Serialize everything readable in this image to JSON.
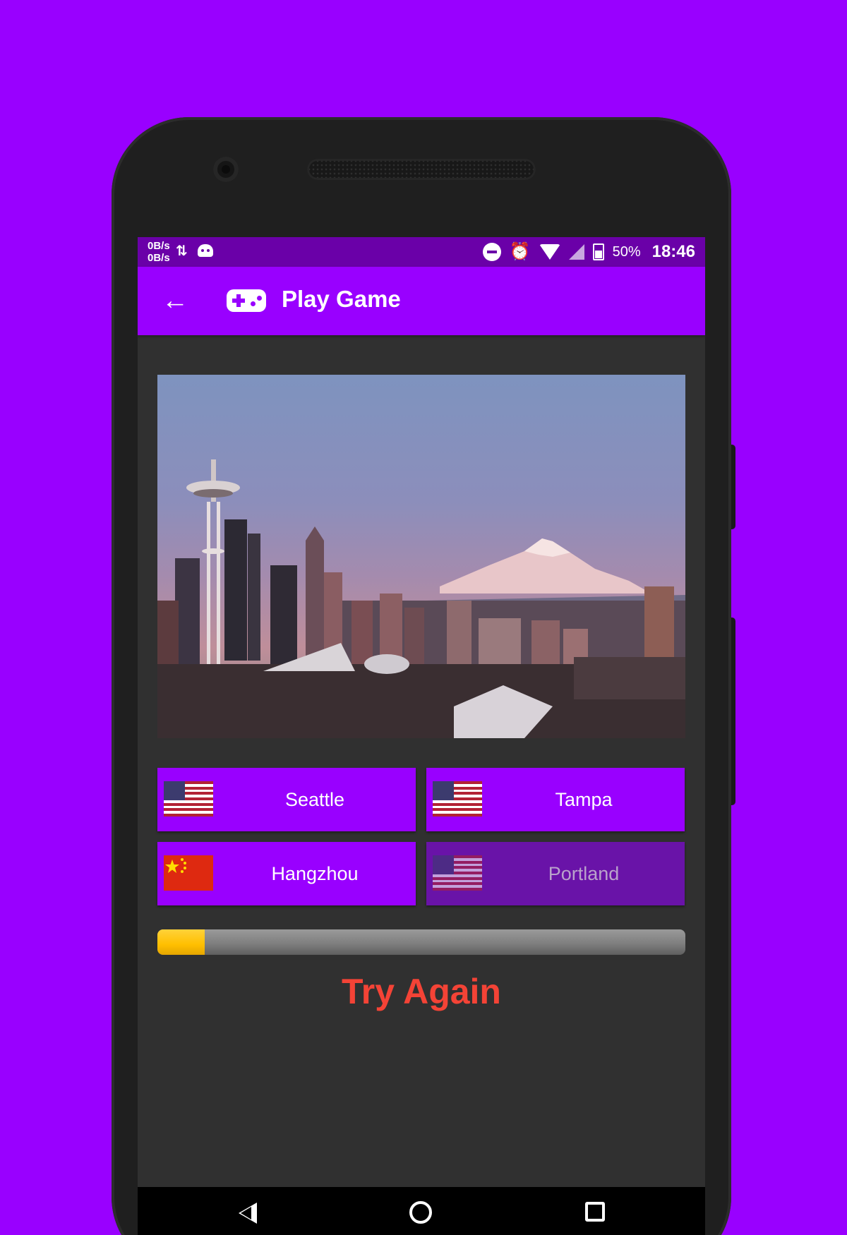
{
  "status_bar": {
    "net_up": "0B/s",
    "net_down": "0B/s",
    "battery_percent": "50%",
    "time": "18:46",
    "icons": [
      "data-transfer-icon",
      "android-icon",
      "do-not-disturb-icon",
      "alarm-icon",
      "wifi-icon",
      "signal-icon",
      "battery-icon"
    ]
  },
  "app_bar": {
    "title": "Play Game",
    "back_icon": "arrow-left-icon",
    "title_icon": "gamepad-icon"
  },
  "question_image": {
    "description_icon": "city-skyline-photo"
  },
  "answers": [
    {
      "label": "Seattle",
      "flag": "us-flag-icon",
      "enabled": true
    },
    {
      "label": "Tampa",
      "flag": "us-flag-icon",
      "enabled": true
    },
    {
      "label": "Hangzhou",
      "flag": "china-flag-icon",
      "enabled": true
    },
    {
      "label": "Portland",
      "flag": "us-flag-icon",
      "enabled": false
    }
  ],
  "progress": {
    "value": 0.09
  },
  "result": {
    "message": "Try Again"
  },
  "nav_bar": {
    "icons": [
      "nav-back-icon",
      "nav-home-icon",
      "nav-recents-icon"
    ]
  },
  "colors": {
    "background": "#9900ff",
    "app_bar": "#9900ff",
    "status_bar": "#6a00a8",
    "answer_button": "#9900ff",
    "answer_button_disabled": "#6913a8",
    "progress_fill": "#ffbf00",
    "result_text": "#f44336",
    "screen_background": "#303030"
  }
}
